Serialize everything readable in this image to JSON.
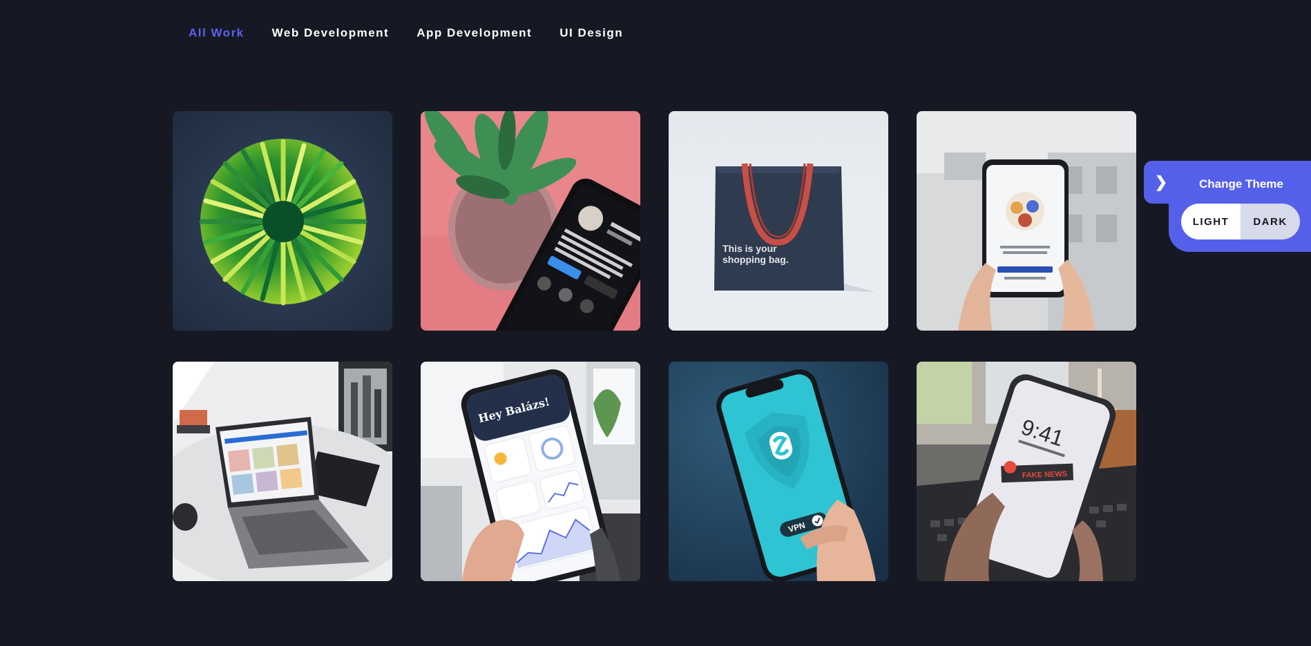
{
  "filters": [
    {
      "label": "All Work",
      "active": true
    },
    {
      "label": "Web Development",
      "active": false
    },
    {
      "label": "App Development",
      "active": false
    },
    {
      "label": "UI Design",
      "active": false
    }
  ],
  "portfolio": [
    {
      "name": "green-straws-photo"
    },
    {
      "name": "phone-instagram-plant-photo"
    },
    {
      "name": "shopping-bag-photo",
      "caption_line1": "This is your",
      "caption_line2": "shopping bag."
    },
    {
      "name": "phone-teams-app-photo"
    },
    {
      "name": "laptop-on-table-photo"
    },
    {
      "name": "phone-weather-app-photo",
      "screen_title": "Hey Balázs!"
    },
    {
      "name": "phone-vpn-app-photo",
      "badge": "VPN"
    },
    {
      "name": "phone-lockscreen-photo",
      "clock": "9:41",
      "label": "FAKE NEWS"
    }
  ],
  "theme": {
    "title": "Change Theme",
    "toggle_icon": "chevron-right-icon",
    "light_label": "LIGHT",
    "dark_label": "DARK"
  },
  "colors": {
    "background": "#161923",
    "accent": "#5560ea",
    "active_filter": "#5a63f0"
  }
}
